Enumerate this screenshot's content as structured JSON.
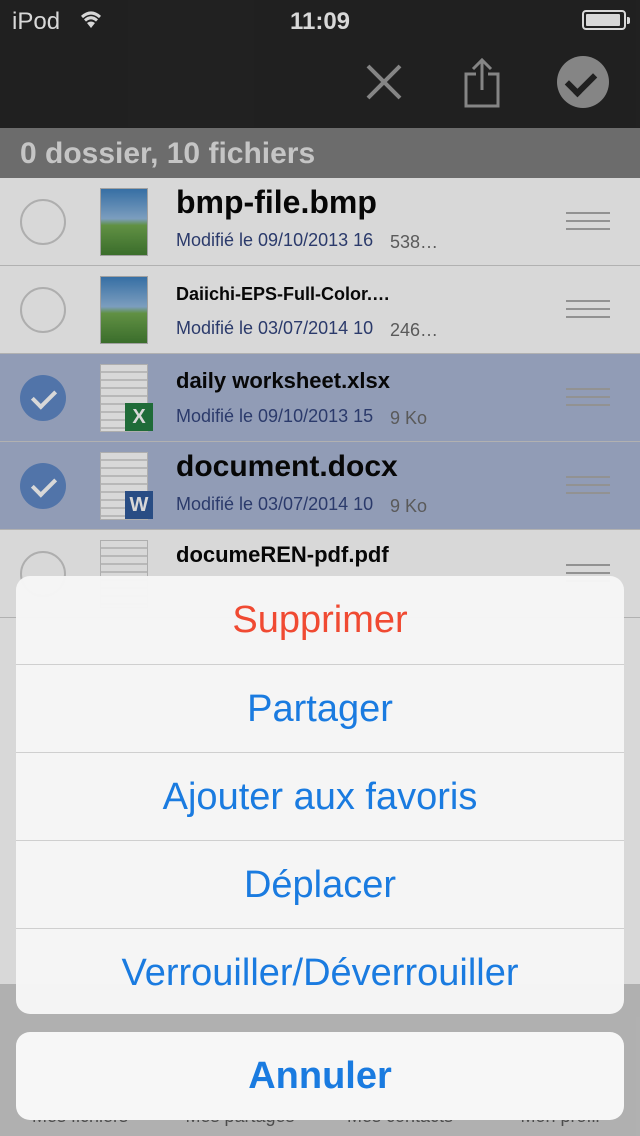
{
  "status": {
    "carrier": "iPod",
    "time": "11:09",
    "battery_level": 0.85
  },
  "nav": {
    "close_icon": "close-icon",
    "share_icon": "share-icon",
    "done_icon": "checkmark-circle-icon"
  },
  "folder_summary": "0 dossier, 10 fichiers",
  "files": [
    {
      "name": "bmp-file.bmp",
      "meta": "Modifié le 09/10/2013 16",
      "size": "538…",
      "selected": false,
      "type": "image"
    },
    {
      "name": "Daiichi-EPS-Full-Color.…",
      "meta": "Modifié le 03/07/2014 10",
      "size": "246…",
      "selected": false,
      "type": "image"
    },
    {
      "name": "daily worksheet.xlsx",
      "meta": "Modifié le 09/10/2013 15",
      "size": "9 Ko",
      "selected": true,
      "type": "excel"
    },
    {
      "name": "document.docx",
      "meta": "Modifié le 03/07/2014 10",
      "size": "9 Ko",
      "selected": true,
      "type": "word"
    },
    {
      "name": "documeREN-pdf.pdf",
      "selected": false,
      "type": "pdf"
    }
  ],
  "tabs": [
    "Mes fichiers",
    "Mes partages",
    "Mes contacts",
    "Mon profil"
  ],
  "action_sheet": {
    "actions": [
      "Supprimer",
      "Partager",
      "Ajouter aux favoris",
      "Déplacer",
      "Verrouiller/Déverrouiller"
    ],
    "cancel": "Annuler",
    "destructive_color": "#f04a32",
    "accent_color": "#1a7be0"
  }
}
